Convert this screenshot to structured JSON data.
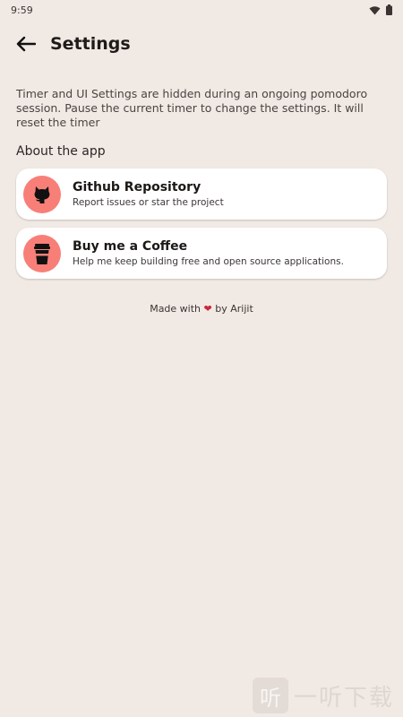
{
  "status_bar": {
    "time": "9:59",
    "wifi_icon": "wifi-icon",
    "battery_icon": "battery-icon"
  },
  "header": {
    "title": "Settings",
    "back_icon": "arrow-back-icon"
  },
  "notice": "Timer and UI Settings are hidden during an ongoing pomodoro session. Pause the current timer to change the settings. It will reset the timer",
  "section": {
    "title": "About the app"
  },
  "cards": [
    {
      "title": "Github Repository",
      "subtitle": "Report issues or star the project",
      "icon": "github-icon"
    },
    {
      "title": "Buy me a Coffee",
      "subtitle": "Help me keep building free and open source applications.",
      "icon": "coffee-cup-icon"
    }
  ],
  "footer": {
    "prefix": "Made with",
    "heart": "❤",
    "suffix": "by Arijit"
  },
  "watermark": {
    "glyph": "听",
    "text": "一听下载"
  },
  "colors": {
    "background": "#f1e9e4",
    "accent": "#f77f78",
    "card": "#ffffff",
    "heart": "#c9283a"
  }
}
